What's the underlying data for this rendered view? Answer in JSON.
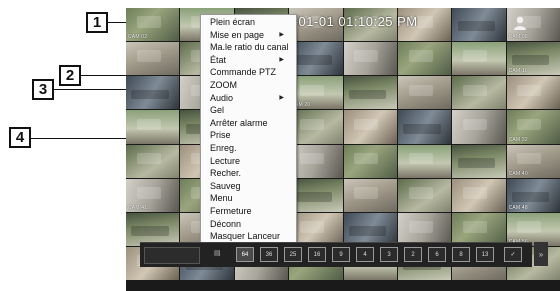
{
  "callouts": [
    "1",
    "2",
    "3",
    "4"
  ],
  "overlay": {
    "timestamp": "6-01-01 01:10:25 PM"
  },
  "menu": {
    "items": [
      {
        "label": "Plein écran",
        "submenu": false
      },
      {
        "label": "Mise en page",
        "submenu": true
      },
      {
        "label": "Ma.le ratio du canal",
        "submenu": false
      },
      {
        "label": "État",
        "submenu": true
      },
      {
        "label": "Commande PTZ",
        "submenu": false
      },
      {
        "label": "ZOOM",
        "submenu": false
      },
      {
        "label": "Audio",
        "submenu": true
      },
      {
        "label": "Gel",
        "submenu": false
      },
      {
        "label": "Arrêter alarme",
        "submenu": false
      },
      {
        "label": "Prise",
        "submenu": false
      },
      {
        "label": "Enreg.",
        "submenu": false
      },
      {
        "label": "Lecture",
        "submenu": false
      },
      {
        "label": "Recher.",
        "submenu": false
      },
      {
        "label": "Sauveg",
        "submenu": false
      },
      {
        "label": "Menu",
        "submenu": false
      },
      {
        "label": "Fermeture",
        "submenu": false
      },
      {
        "label": "Déconn",
        "submenu": false
      },
      {
        "label": "Masquer Lanceur",
        "submenu": false
      }
    ]
  },
  "cameras": [
    "CAM 02",
    "",
    "",
    "",
    "",
    "",
    "",
    "CAM 08",
    "",
    "",
    "",
    "",
    "",
    "",
    "",
    "CAM 16",
    "",
    "",
    "",
    "CAM 20",
    "",
    "",
    "",
    "",
    "",
    "",
    "",
    "",
    "",
    "",
    "",
    "CAM 32",
    "",
    "",
    "",
    "",
    "",
    "",
    "",
    "CAM 40",
    "CAM 41",
    "",
    "",
    "",
    "",
    "",
    "",
    "CAM 48",
    "",
    "",
    "",
    "",
    "",
    "",
    "",
    "CAM 56",
    "",
    "",
    "",
    "",
    "",
    "",
    "",
    ""
  ],
  "toolbar": {
    "layouts": [
      "64",
      "36",
      "25",
      "16",
      "9",
      "4",
      "3",
      "2",
      "6",
      "8",
      "13"
    ],
    "active_layout": "64",
    "collapse_label": "»"
  }
}
